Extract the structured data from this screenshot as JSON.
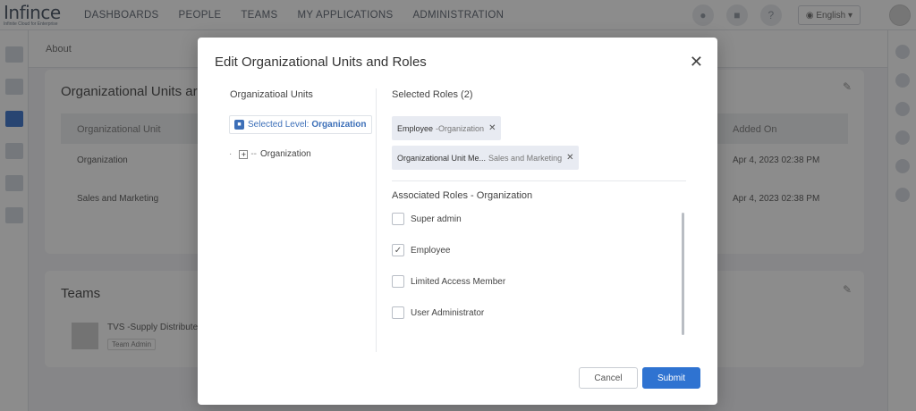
{
  "header": {
    "logo_text": "Infince",
    "logo_tagline": "Infinite Cloud for Enterprise",
    "nav": [
      "DASHBOARDS",
      "PEOPLE",
      "TEAMS",
      "MY APPLICATIONS",
      "ADMINISTRATION"
    ],
    "language": "English"
  },
  "page": {
    "about_label": "About",
    "org_card_title": "Organizational Units ar",
    "col_org_unit": "Organizational Unit",
    "col_added_on": "Added On",
    "rows": [
      {
        "unit": "Organization",
        "added_on": "Apr 4, 2023 02:38 PM"
      },
      {
        "unit": "Sales and Marketing",
        "added_on": "Apr 4, 2023 02:38 PM"
      }
    ],
    "teams_title": "Teams",
    "team_name": "TVS -Supply Distribute...",
    "team_badge": "Team Admin"
  },
  "modal": {
    "title": "Edit Organizational Units and Roles",
    "org_units_label": "Organizatioal Units",
    "selected_level_prefix": "Selected Level:",
    "selected_level_value": "Organization",
    "tree_root": "Organization",
    "selected_roles_label": "Selected Roles (2)",
    "chips": [
      {
        "role": "Employee",
        "sep": " - ",
        "unit": "Organization"
      },
      {
        "role": "Organizational Unit Me...",
        "sep": " ",
        "unit": "Sales and Marketing"
      }
    ],
    "associated_label": "Associated Roles - Organization",
    "roles": [
      {
        "label": "Super admin",
        "checked": false
      },
      {
        "label": "Employee",
        "checked": true
      },
      {
        "label": "Limited Access Member",
        "checked": false
      },
      {
        "label": "User Administrator",
        "checked": false
      }
    ],
    "cancel_label": "Cancel",
    "submit_label": "Submit"
  },
  "colors": {
    "primary": "#2f73d1",
    "link": "#3c6fb8",
    "chip_bg": "#e8ebf2"
  }
}
